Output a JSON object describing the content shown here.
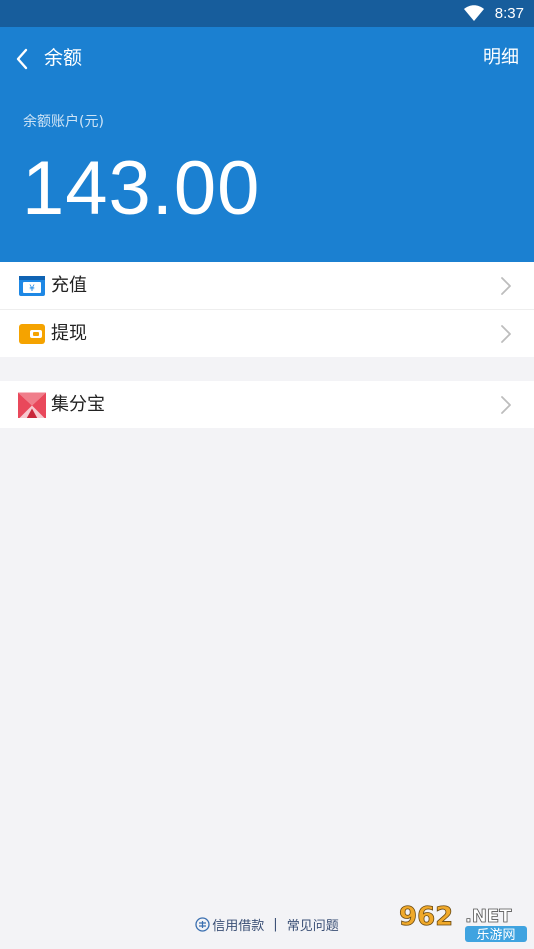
{
  "status_bar": {
    "time": "8:37",
    "wifi_icon": "wifi-icon"
  },
  "header": {
    "back_icon": "chevron-left-icon",
    "title": "余额",
    "detail_link": "明细",
    "balance_label": "余额账户(元)",
    "balance_amount": "143.00"
  },
  "menu_group_1": [
    {
      "icon": "recharge-card-icon",
      "label": "充值"
    },
    {
      "icon": "wallet-icon",
      "label": "提现"
    }
  ],
  "menu_group_2": [
    {
      "icon": "jifenbao-logo-icon",
      "label": "集分宝"
    }
  ],
  "footer": {
    "icon": "credit-loan-icon",
    "link1": "信用借款",
    "separator": "|",
    "link2": "常见问题"
  },
  "watermark": {
    "logo_text": "962.NET",
    "logo_subtext": "乐游网"
  },
  "colors": {
    "primary": "#1b80d1",
    "status_bar": "#175d9c",
    "background": "#f3f3f6",
    "recharge_icon": "#1e88e5",
    "wallet_icon": "#f5a300",
    "jifenbao_icon": "#e9485b"
  }
}
